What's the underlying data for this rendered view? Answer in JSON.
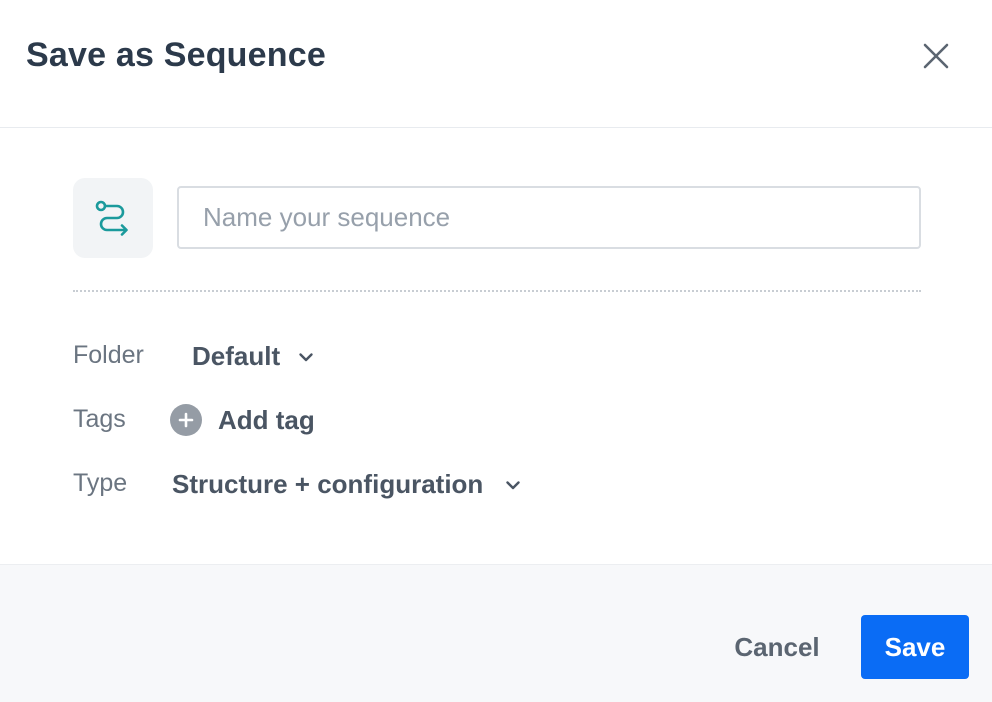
{
  "dialog": {
    "title": "Save as Sequence",
    "close_icon": "close-icon"
  },
  "form": {
    "sequence_icon": "sequence-route-icon",
    "sequence_icon_color": "#1b9a9c",
    "name_placeholder": "Name your sequence",
    "name_value": "",
    "folder": {
      "label": "Folder",
      "value": "Default"
    },
    "tags": {
      "label": "Tags",
      "add_label": "Add tag",
      "add_icon": "plus-circle-icon"
    },
    "type": {
      "label": "Type",
      "value": "Structure + configuration"
    }
  },
  "footer": {
    "cancel_label": "Cancel",
    "save_label": "Save",
    "save_color": "#0a6cf5"
  }
}
